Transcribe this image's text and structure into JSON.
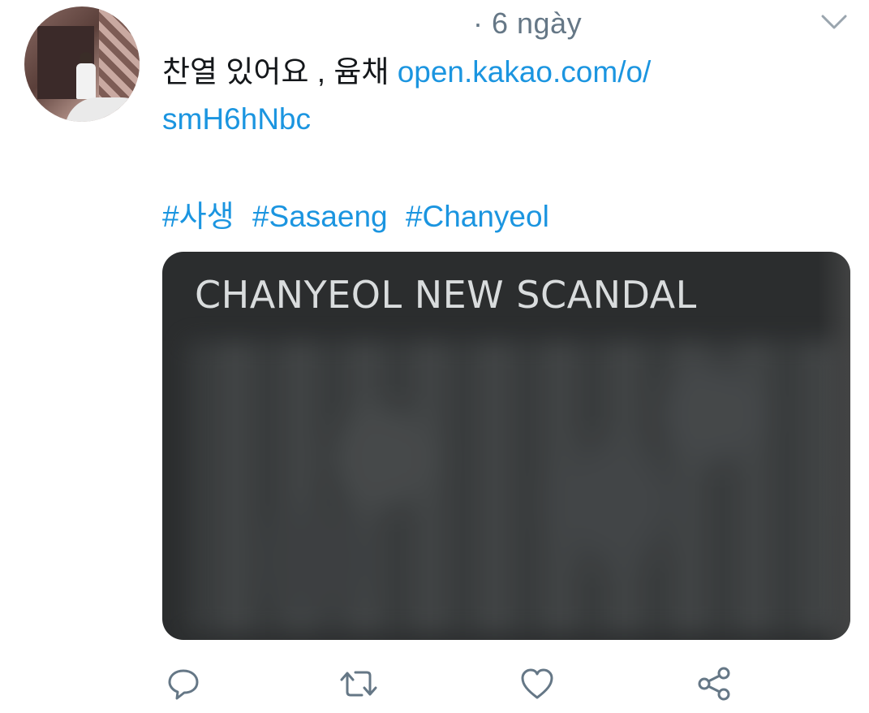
{
  "tweet": {
    "time": "· 6 ngày",
    "text_prefix": "찬열 있어요 , 윰채 ",
    "link_line1": "open.kakao.com/o/",
    "link_line2": "smH6hNbc",
    "hashtags": [
      "#사생",
      "#Sasaeng",
      "#Chanyeol"
    ]
  },
  "media": {
    "title": "CHANYEOL NEW SCANDAL"
  },
  "icons": {
    "avatar": "avatar",
    "more": "chevron-down-icon",
    "reply": "reply-icon",
    "retweet": "retweet-icon",
    "like": "heart-icon",
    "share": "share-icon"
  },
  "colors": {
    "link": "#1b95e0",
    "muted": "#657786",
    "icon": "#657786"
  }
}
